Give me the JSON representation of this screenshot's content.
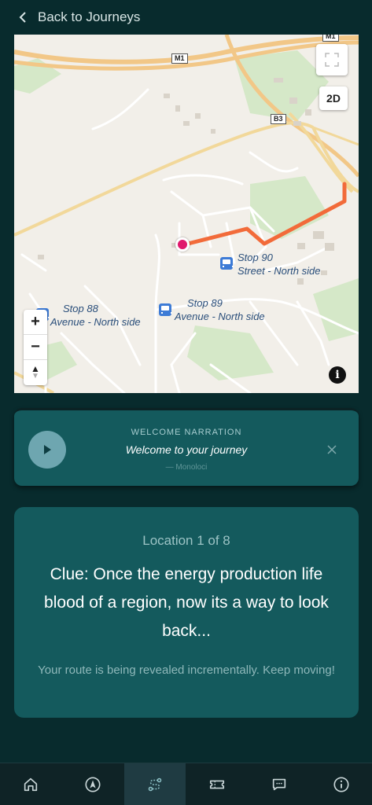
{
  "header": {
    "back_label": "Back to Journeys"
  },
  "map": {
    "view_mode_label": "2D",
    "zoom_in_label": "+",
    "zoom_out_label": "−",
    "compass_label": "▲",
    "info_label": "i",
    "road_shields": [
      "M1",
      "B3"
    ],
    "stops": [
      {
        "name": "Stop 88",
        "street": "Avenue - North side"
      },
      {
        "name": "Stop 89",
        "street": "Avenue - North side"
      },
      {
        "name": "Stop 90",
        "street": "Street - North side"
      }
    ],
    "colors": {
      "route": "#f26b3a",
      "current_location": "#e0196c",
      "bus_stop": "#3d7bd6"
    }
  },
  "narration": {
    "heading": "WELCOME NARRATION",
    "title": "Welcome to your journey",
    "source": "— Monoloci"
  },
  "clue_card": {
    "location_label": "Location 1 of 8",
    "clue": "Clue: Once the energy production life blood of a region, now its a way to look back...",
    "reveal_note": "Your route is being revealed incrementally. Keep moving!"
  },
  "bottom_nav": {
    "items": [
      {
        "icon": "home-icon",
        "active": false
      },
      {
        "icon": "navigation-icon",
        "active": false
      },
      {
        "icon": "route-icon",
        "active": true
      },
      {
        "icon": "ticket-icon",
        "active": false
      },
      {
        "icon": "chat-icon",
        "active": false
      },
      {
        "icon": "info-icon",
        "active": false
      }
    ]
  },
  "theme": {
    "background": "#082b2d",
    "card": "#145a5d",
    "nav": "#0f2326"
  }
}
